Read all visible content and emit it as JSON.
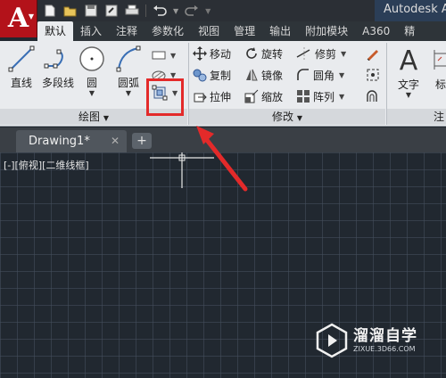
{
  "app": {
    "logo_letter": "A",
    "title": "Autodesk A"
  },
  "quick_access": {
    "icons": [
      "new-file-icon",
      "open-folder-icon",
      "save-icon",
      "save-as-icon",
      "print-icon",
      "undo-icon",
      "redo-icon"
    ]
  },
  "ribbon_tabs": [
    "默认",
    "插入",
    "注释",
    "参数化",
    "视图",
    "管理",
    "输出",
    "附加模块",
    "A360",
    "精"
  ],
  "active_tab": "默认",
  "draw_panel": {
    "footer": "绘图",
    "line": "直线",
    "polyline": "多段线",
    "circle": "圆",
    "arc": "圆弧"
  },
  "modify_panel": {
    "footer": "修改",
    "move": "移动",
    "rotate": "旋转",
    "trim": "修剪",
    "copy": "复制",
    "mirror": "镜像",
    "fillet": "圆角",
    "stretch": "拉伸",
    "scale": "缩放",
    "array": "阵列"
  },
  "annotation_panel": {
    "text": "文字",
    "dim_partial": "标",
    "footer_partial": "注"
  },
  "file_tabs": {
    "doc": "Drawing1*",
    "close": "✕",
    "new": "+"
  },
  "viewport": {
    "label": "[-][俯视][二维线框]"
  },
  "watermark": {
    "title": "溜溜自学",
    "url": "ZIXUE.3D66.COM"
  },
  "colors": {
    "accent_red": "#e32a2a",
    "canvas_bg": "#212830",
    "app_red": "#b3121a"
  }
}
